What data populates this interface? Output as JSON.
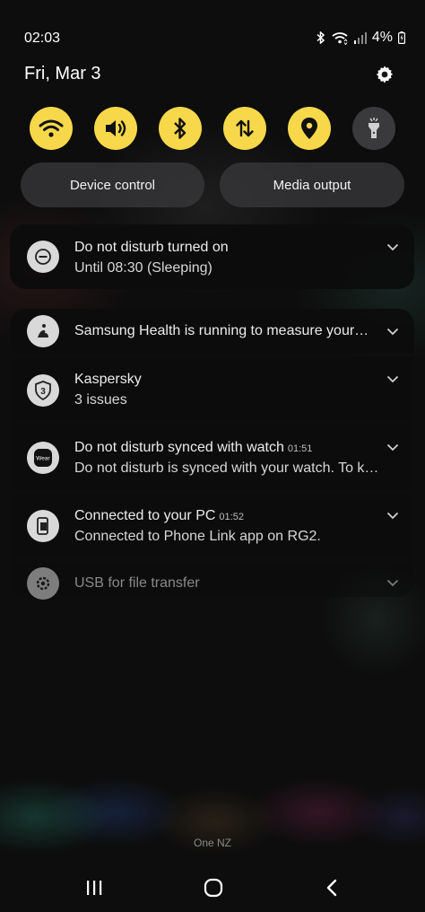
{
  "status_bar": {
    "time": "02:03",
    "battery": "4%"
  },
  "header": {
    "date": "Fri, Mar 3"
  },
  "quick_settings": {
    "toggles": [
      {
        "icon": "wifi-icon",
        "on": true
      },
      {
        "icon": "sound-icon",
        "on": true
      },
      {
        "icon": "bluetooth-icon",
        "on": true
      },
      {
        "icon": "mobile-data-icon",
        "on": true
      },
      {
        "icon": "location-icon",
        "on": true
      },
      {
        "icon": "flashlight-icon",
        "on": false
      }
    ],
    "device_control": "Device control",
    "media_output": "Media output"
  },
  "notifications": {
    "dnd": {
      "title": "Do not disturb turned on",
      "body": "Until 08:30 (Sleeping)"
    },
    "items": [
      {
        "title": "Samsung Health is running to measure your…",
        "time": "",
        "body": ""
      },
      {
        "title": "Kaspersky",
        "time": "",
        "body": "3 issues"
      },
      {
        "title": "Do not disturb synced with watch",
        "time": "01:51",
        "body": "Do not disturb is synced with your watch. To k…"
      },
      {
        "title": "Connected to your PC",
        "time": "01:52",
        "body": "Connected to Phone Link app on RG2."
      },
      {
        "title": "USB for file transfer",
        "time": "",
        "body": ""
      }
    ]
  },
  "footer": {
    "carrier": "One NZ"
  },
  "colors": {
    "toggle_on": "#f7d84a",
    "toggle_off": "#3a3a3c"
  }
}
